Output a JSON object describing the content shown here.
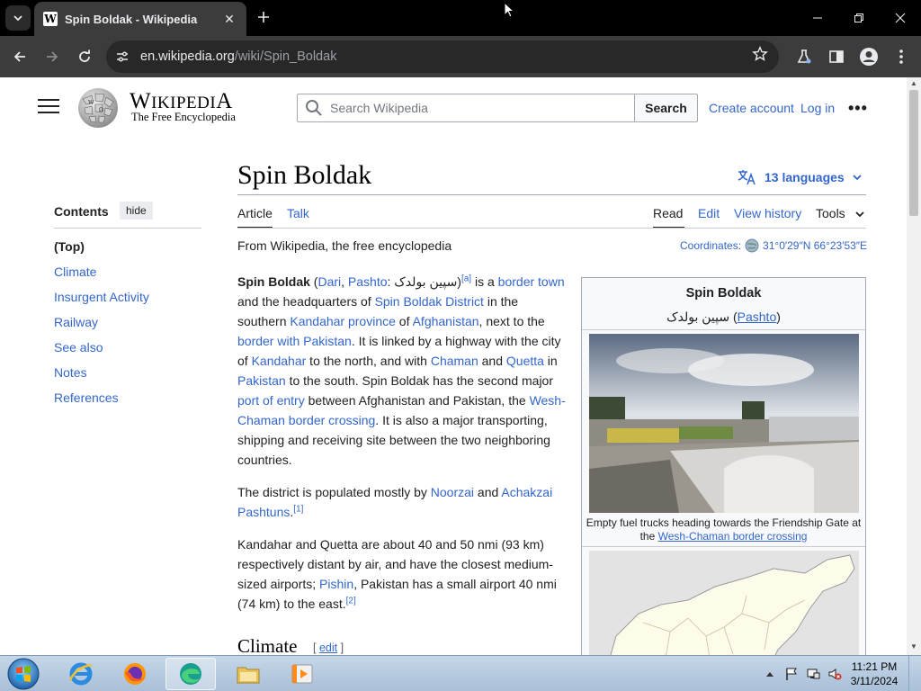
{
  "browser": {
    "tab_title": "Spin Boldak - Wikipedia",
    "url_host": "en.wikipedia.org",
    "url_path": "/wiki/Spin_Boldak"
  },
  "header": {
    "wordmark": "Wikipedia",
    "tagline": "The Free Encyclopedia",
    "search_placeholder": "Search Wikipedia",
    "search_button": "Search",
    "create_account": "Create account",
    "log_in": "Log in",
    "more": "•••"
  },
  "toc": {
    "title": "Contents",
    "hide": "hide",
    "items": [
      "(Top)",
      "Climate",
      "Insurgent Activity",
      "Railway",
      "See also",
      "Notes",
      "References"
    ]
  },
  "article": {
    "title": "Spin Boldak",
    "languages": "13 languages",
    "tabs": {
      "article": "Article",
      "talk": "Talk",
      "read": "Read",
      "edit": "Edit",
      "history": "View history",
      "tools": "Tools"
    },
    "from_wikipedia": "From Wikipedia, the free encyclopedia",
    "coordinates_label": "Coordinates:",
    "coordinates_value": "31°0′29″N 66°23′53″E",
    "section_heading": "Climate",
    "section_edit": "edit",
    "lead": {
      "bold": "Spin Boldak",
      "p1_lang1": "Dari",
      "p1_lang2": "Pashto",
      "p1_native": "سپین بولدک",
      "p1_ref": "[a]",
      "p1_t1": " is a ",
      "p1_l_border_town": "border town",
      "p1_t2": " and the headquarters of ",
      "p1_l_district": "Spin Boldak District",
      "p1_t3": " in the southern ",
      "p1_l_kandahar_prov": "Kandahar province",
      "p1_t4": " of ",
      "p1_l_afghanistan": "Afghanistan",
      "p1_t5": ", next to the ",
      "p1_l_border_pak": "border with Pakistan",
      "p1_t6": ". It is linked by a highway with the city of ",
      "p1_l_kandahar": "Kandahar",
      "p1_t7": " to the north, and with ",
      "p1_l_chaman": "Chaman",
      "p1_t8": " and ",
      "p1_l_quetta": "Quetta",
      "p1_t9": " in ",
      "p1_l_pakistan": "Pakistan",
      "p1_t10": " to the south. Spin Boldak has the second major ",
      "p1_l_port": "port of entry",
      "p1_t11": " between Afghanistan and Pakistan, the ",
      "p1_l_wesh": "Wesh-Chaman border crossing",
      "p1_t12": ". It is also a major transporting, shipping and receiving site between the two neighboring countries.",
      "p2_t1": "The district is populated mostly by ",
      "p2_l_noorzai": "Noorzai",
      "p2_t2": " and ",
      "p2_l_achakzai": "Achakzai Pashtuns",
      "p2_t3": ".",
      "p2_ref": "[1]",
      "p3_t1": "Kandahar and Quetta are about 40 and 50 nmi (93 km) respectively distant by air, and have the closest medium-sized airports; ",
      "p3_l_pishin": "Pishin",
      "p3_t2": ", Pakistan has a small airport 40 nmi (74 km) to the east.",
      "p3_ref": "[2]"
    },
    "infobox": {
      "name": "Spin Boldak",
      "native": "سپین بولدک",
      "native_lang": "Pashto",
      "caption_text": "Empty fuel trucks heading towards the Friendship Gate at the ",
      "caption_link": "Wesh-Chaman border crossing"
    }
  },
  "taskbar": {
    "time": "11:21 PM",
    "date": "3/11/2024"
  }
}
